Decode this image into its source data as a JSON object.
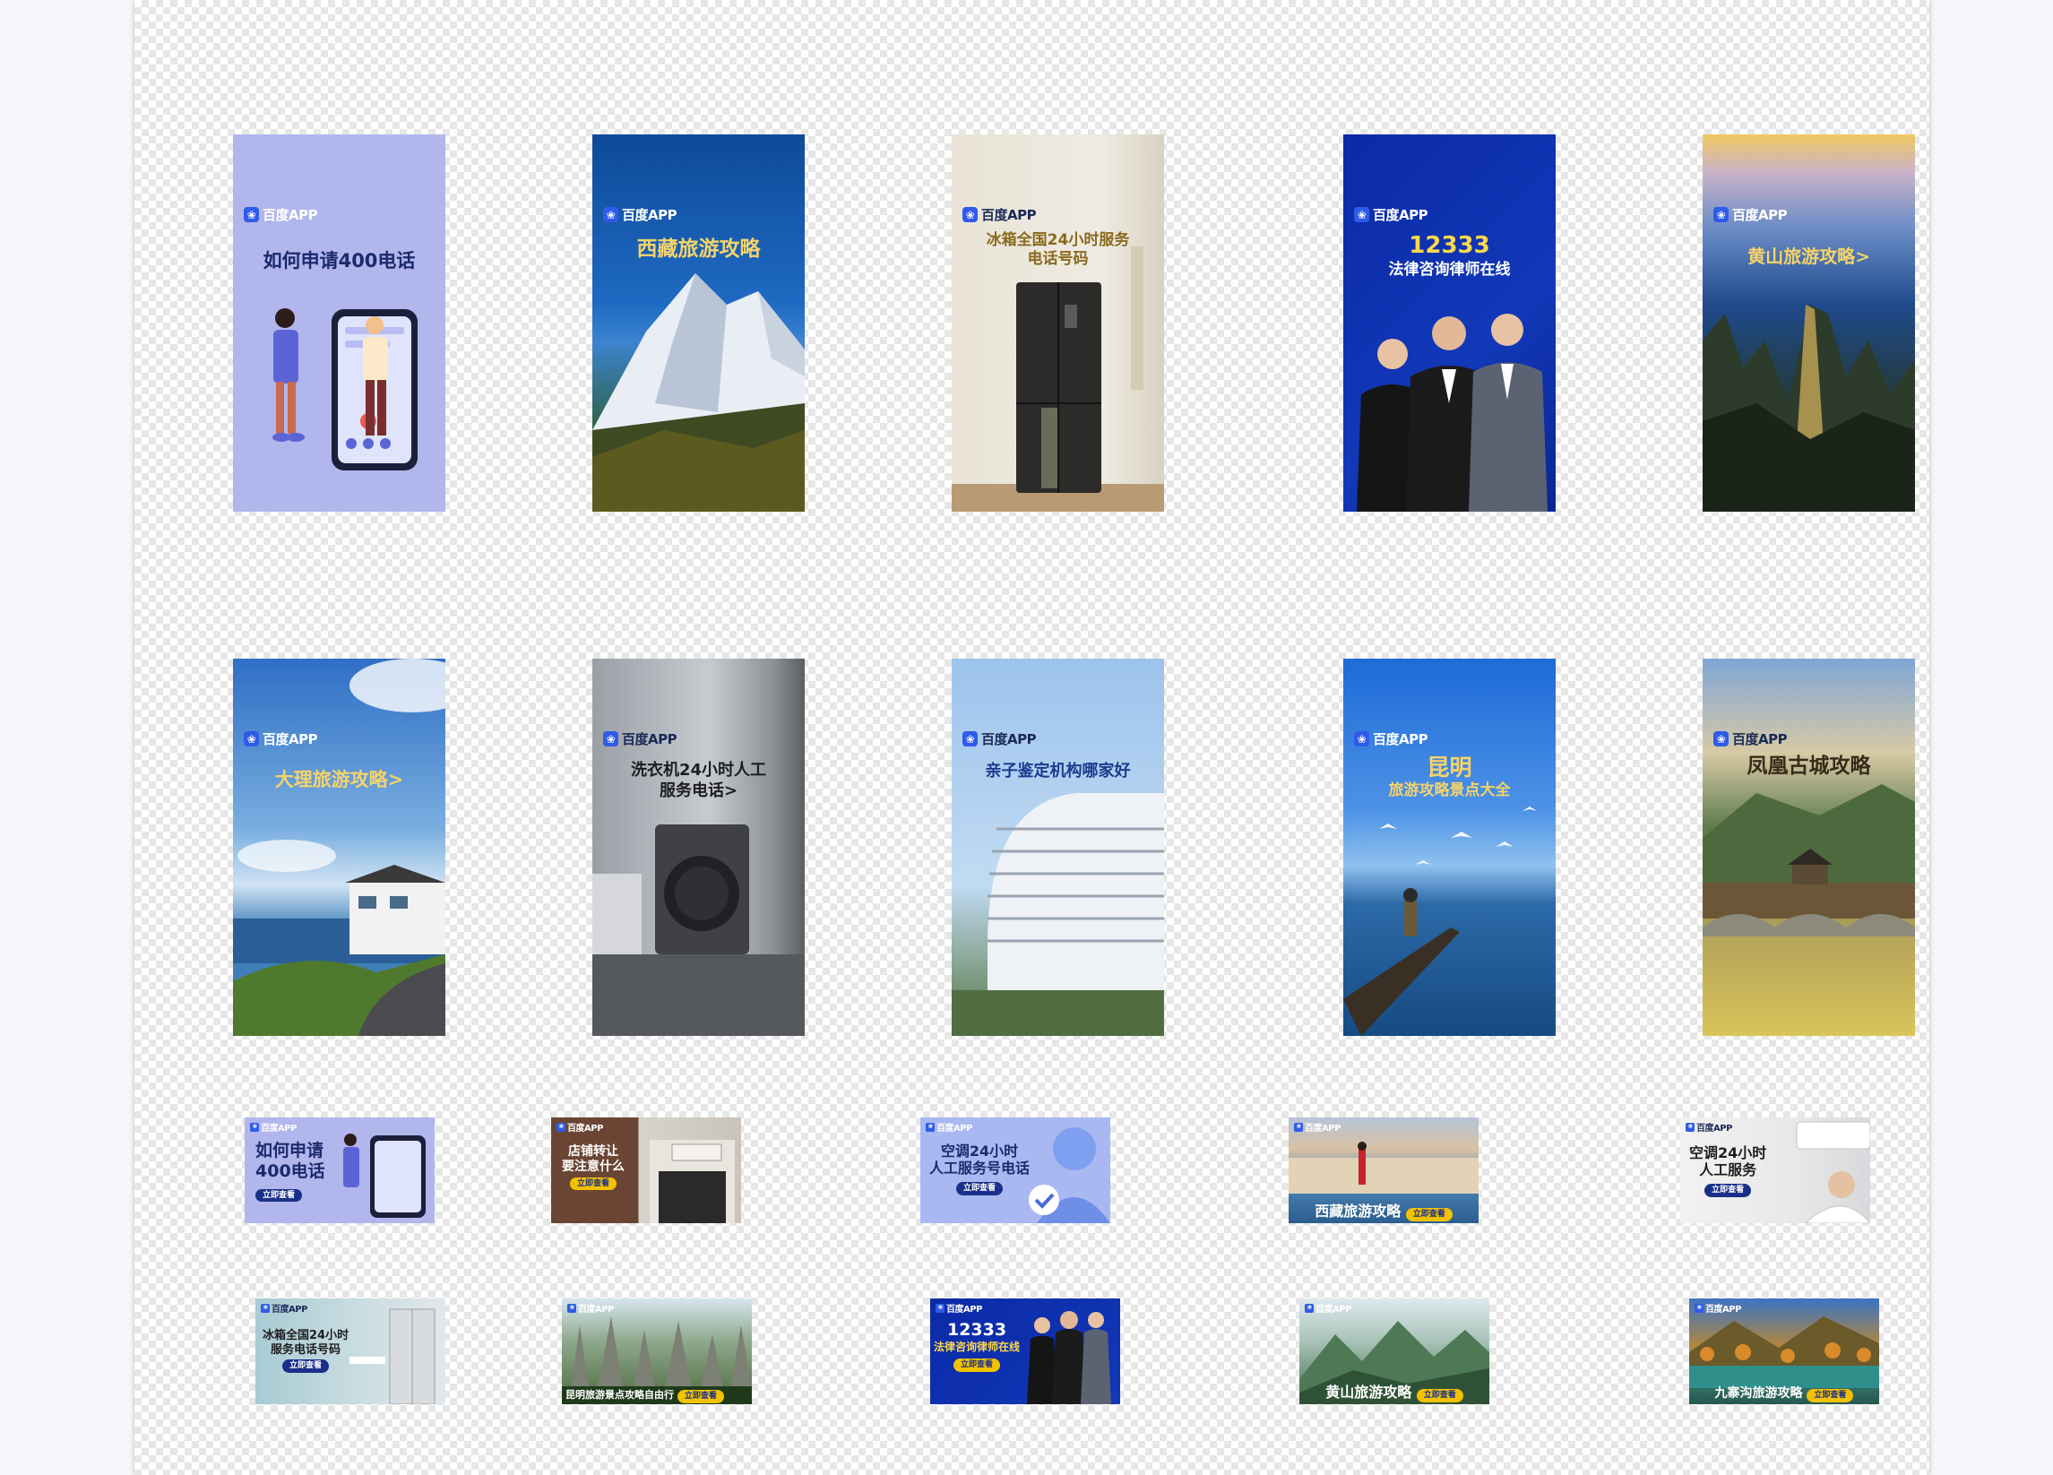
{
  "tall_banners": [
    {
      "brand": "百度APP",
      "headline": "如何申请400电话"
    },
    {
      "brand": "百度APP",
      "headline": "西藏旅游攻略"
    },
    {
      "brand": "百度APP",
      "headline_1": "冰箱全国24小时服务",
      "headline_2": "电话号码"
    },
    {
      "brand": "百度APP",
      "headline_1": "12333",
      "headline_2": "法律咨询律师在线"
    },
    {
      "brand": "百度APP",
      "headline": "黄山旅游攻略>"
    },
    {
      "brand": "百度APP",
      "headline": "大理旅游攻略>"
    },
    {
      "brand": "百度APP",
      "headline_1": "洗衣机24小时人工",
      "headline_2": "服务电话>"
    },
    {
      "brand": "百度APP",
      "headline": "亲子鉴定机构哪家好"
    },
    {
      "brand": "百度APP",
      "headline_1": "昆明",
      "headline_2": "旅游攻略景点大全"
    },
    {
      "brand": "百度APP",
      "headline": "凤凰古城攻略"
    }
  ],
  "wide_banners": [
    {
      "brand": "百度APP",
      "line_1": "如何申请",
      "line_2": "400电话",
      "cta": "立即查看"
    },
    {
      "brand": "百度APP",
      "line_1": "店铺转让",
      "line_2": "要注意什么",
      "cta": "立即查看"
    },
    {
      "brand": "百度APP",
      "line_1": "空调24小时",
      "line_2": "人工服务号电话",
      "cta": "立即查看"
    },
    {
      "brand": "百度APP",
      "line_1": "西藏旅游攻略",
      "cta": "立即查看"
    },
    {
      "brand": "百度APP",
      "line_1": "空调24小时",
      "line_2": "人工服务",
      "cta": "立即查看"
    },
    {
      "brand": "百度APP",
      "line_1": "冰箱全国24小时",
      "line_2": "服务电话号码",
      "cta": "立即查看"
    },
    {
      "brand": "百度APP",
      "line_1": "昆明旅游景点攻略自由行",
      "cta": "立即查看"
    },
    {
      "brand": "百度APP",
      "line_1": "12333",
      "line_2": "法律咨询律师在线",
      "cta": "立即查看"
    },
    {
      "brand": "百度APP",
      "line_1": "黄山旅游攻略",
      "cta": "立即查看"
    },
    {
      "brand": "百度APP",
      "line_1": "九寨沟旅游攻略",
      "cta": "立即查看"
    }
  ],
  "colors": {
    "baidu_blue": "#2f5be8",
    "cta_navy": "#1a2f8a",
    "cta_gold": "#f2c200",
    "headline_gold": "#f5d36a"
  },
  "icons": {
    "brand_logo": "baidu-paw-icon"
  }
}
